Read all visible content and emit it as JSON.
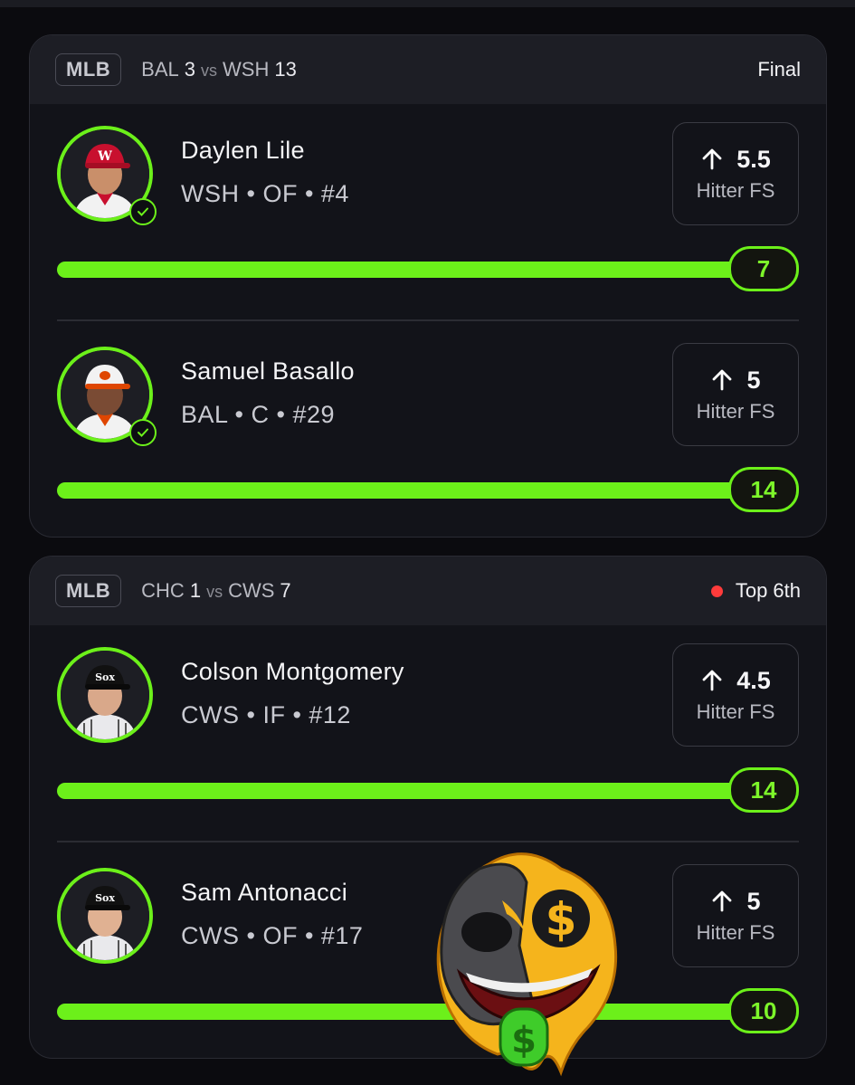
{
  "accent_color": "#6cf01a",
  "games": [
    {
      "league": "MLB",
      "away_team": "BAL",
      "away_score": "3",
      "vs": "vs",
      "home_team": "WSH",
      "home_score": "13",
      "status": "Final",
      "live": false,
      "players": [
        {
          "name": "Daylen Lile",
          "meta": "WSH • OF • #4",
          "line": "5.5",
          "stat": "Hitter FS",
          "value": "7",
          "progress": 1.0,
          "verified": true,
          "cap_color": "#c8102e"
        },
        {
          "name": "Samuel Basallo",
          "meta": "BAL • C • #29",
          "line": "5",
          "stat": "Hitter FS",
          "value": "14",
          "progress": 1.0,
          "verified": true,
          "cap_color": "#f2f2f2"
        }
      ]
    },
    {
      "league": "MLB",
      "away_team": "CHC",
      "away_score": "1",
      "vs": "vs",
      "home_team": "CWS",
      "home_score": "7",
      "status": "Top 6th",
      "live": true,
      "players": [
        {
          "name": "Colson Montgomery",
          "meta": "CWS • IF • #12",
          "line": "4.5",
          "stat": "Hitter FS",
          "value": "14",
          "progress": 1.0,
          "verified": false,
          "cap_color": "#111111"
        },
        {
          "name": "Sam Antonacci",
          "meta": "CWS • OF • #17",
          "line": "5",
          "stat": "Hitter FS",
          "value": "10",
          "progress": 1.0,
          "verified": false,
          "cap_color": "#111111"
        }
      ]
    }
  ]
}
